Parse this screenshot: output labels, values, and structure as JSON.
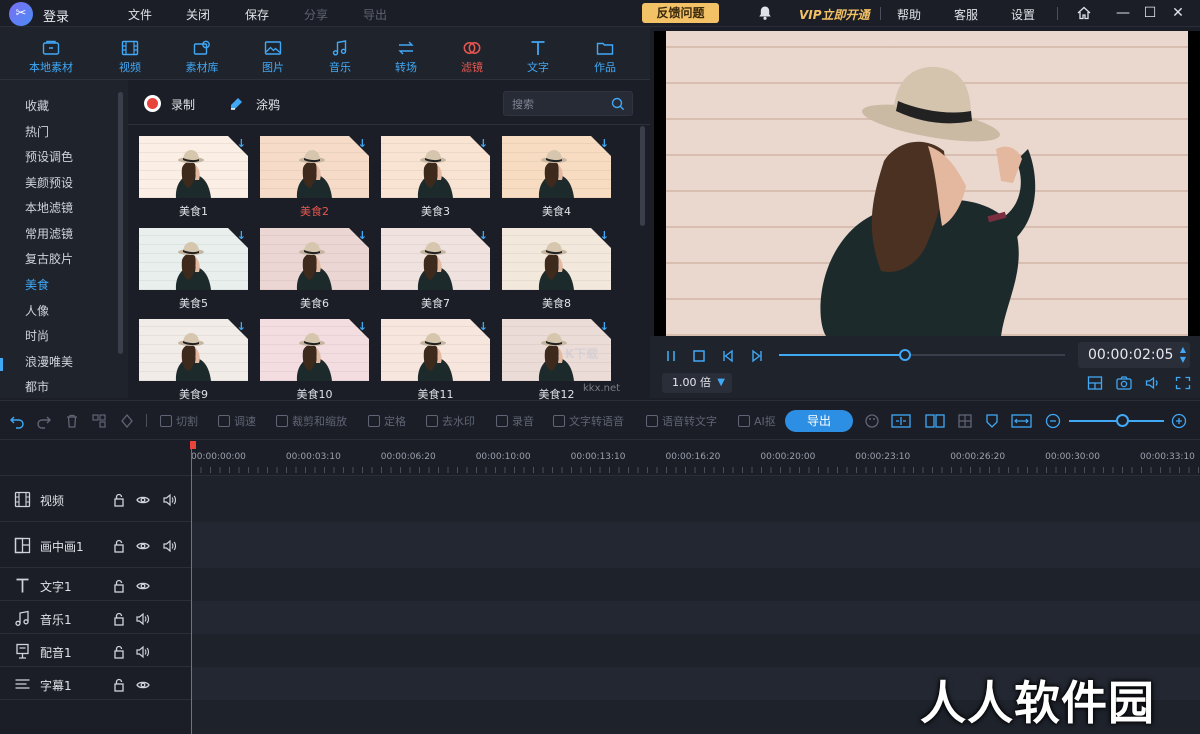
{
  "titlebar": {
    "login": "登录",
    "menu": [
      {
        "label": "文件",
        "enabled": true
      },
      {
        "label": "关闭",
        "enabled": true
      },
      {
        "label": "保存",
        "enabled": true
      },
      {
        "label": "分享",
        "enabled": false
      },
      {
        "label": "导出",
        "enabled": false
      }
    ],
    "feedback": "反馈问题",
    "vip": "VIP立即开通",
    "help": "帮助",
    "service": "客服",
    "settings": "设置",
    "win_min": "—",
    "win_max": "☐",
    "win_close": "✕"
  },
  "category_tabs": [
    {
      "label": "本地素材",
      "icon": "folder-box-icon",
      "active": false
    },
    {
      "label": "视频",
      "icon": "film-icon",
      "active": false
    },
    {
      "label": "素材库",
      "icon": "library-icon",
      "active": false
    },
    {
      "label": "图片",
      "icon": "image-icon",
      "active": false
    },
    {
      "label": "音乐",
      "icon": "music-icon",
      "active": false
    },
    {
      "label": "转场",
      "icon": "transition-icon",
      "active": false
    },
    {
      "label": "滤镜",
      "icon": "filter-icon",
      "active": true
    },
    {
      "label": "文字",
      "icon": "text-icon",
      "active": false
    },
    {
      "label": "作品",
      "icon": "works-folder-icon",
      "active": false
    }
  ],
  "sidebar": {
    "items": [
      "收藏",
      "热门",
      "预设调色",
      "美颜预设",
      "本地滤镜",
      "常用滤镜",
      "复古胶片",
      "美食",
      "人像",
      "时尚",
      "浪漫唯美",
      "都市"
    ],
    "active_index": 7
  },
  "content_toolbar": {
    "record": "录制",
    "graffiti": "涂鸦",
    "search_placeholder": "搜索"
  },
  "filters": [
    {
      "label": "美食1",
      "tint": "#fbeee4",
      "selected": false
    },
    {
      "label": "美食2",
      "tint": "#f6dcc8",
      "selected": true
    },
    {
      "label": "美食3",
      "tint": "#f9e3d2",
      "selected": false
    },
    {
      "label": "美食4",
      "tint": "#f7dcc2",
      "selected": false
    },
    {
      "label": "美食5",
      "tint": "#e8efec",
      "selected": false
    },
    {
      "label": "美食6",
      "tint": "#ecd6d3",
      "selected": false
    },
    {
      "label": "美食7",
      "tint": "#f0e2df",
      "selected": false
    },
    {
      "label": "美食8",
      "tint": "#f3e8dc",
      "selected": false
    },
    {
      "label": "美食9",
      "tint": "#f2ece8",
      "selected": false
    },
    {
      "label": "美食10",
      "tint": "#f3dde0",
      "selected": false
    },
    {
      "label": "美食11",
      "tint": "#f6e6de",
      "selected": false
    },
    {
      "label": "美食12",
      "tint": "#ecdcd8",
      "selected": false
    }
  ],
  "player": {
    "timecode": "00:00:02:05",
    "speed": "1.00 倍",
    "progress": 0.44
  },
  "edit_toolbar": {
    "items": [
      "切割",
      "调速",
      "裁剪和缩放",
      "定格",
      "去水印",
      "录音",
      "文字转语音",
      "语音转文字",
      "AI抠"
    ],
    "export": "导出",
    "zoom_level": 0.5
  },
  "timeline": {
    "ticks": [
      "00:00:00:00",
      "00:00:03:10",
      "00:00:06:20",
      "00:00:10:00",
      "00:00:13:10",
      "00:00:16:20",
      "00:00:20:00",
      "00:00:23:10",
      "00:00:26:20",
      "00:00:30:00",
      "00:00:33:10"
    ],
    "tracks": [
      {
        "name": "视频",
        "icon": "film-icon",
        "controls": [
          "lock",
          "eye",
          "volume"
        ]
      },
      {
        "name": "画中画1",
        "icon": "pip-icon",
        "controls": [
          "lock",
          "eye",
          "volume"
        ]
      },
      {
        "name": "文字1",
        "icon": "text-icon",
        "controls": [
          "lock",
          "eye"
        ]
      },
      {
        "name": "音乐1",
        "icon": "music-icon",
        "controls": [
          "lock",
          "volume"
        ]
      },
      {
        "name": "配音1",
        "icon": "dub-icon",
        "controls": [
          "lock",
          "volume"
        ]
      },
      {
        "name": "字幕1",
        "icon": "subtitle-icon",
        "controls": [
          "lock",
          "eye"
        ]
      }
    ]
  },
  "watermarks": {
    "main": "人人软件园",
    "center": "K下载",
    "center_url": "kkx.net"
  },
  "colors": {
    "accent": "#40a8f5",
    "active_red": "#e8574f",
    "vip_gold": "#f3c166",
    "export_blue": "#2d8fe3"
  }
}
